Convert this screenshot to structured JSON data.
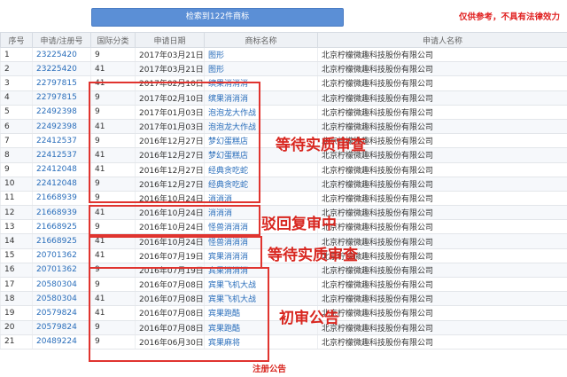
{
  "search_button": "检索到122件商标",
  "disclaimer": "仅供参考，不具有法律效力",
  "columns": [
    "序号",
    "申请/注册号",
    "国际分类",
    "申请日期",
    "商标名称",
    "申请人名称"
  ],
  "rows": [
    {
      "idx": "1",
      "num": "23225420",
      "cls": "9",
      "date": "2017年03月21日",
      "name": "图形",
      "applicant": "北京柠檬微趣科技股份有限公司"
    },
    {
      "idx": "2",
      "num": "23225420",
      "cls": "41",
      "date": "2017年03月21日",
      "name": "图形",
      "applicant": "北京柠檬微趣科技股份有限公司"
    },
    {
      "idx": "3",
      "num": "22797815",
      "cls": "41",
      "date": "2017年02月10日",
      "name": "缤果消消消",
      "applicant": "北京柠檬微趣科技股份有限公司"
    },
    {
      "idx": "4",
      "num": "22797815",
      "cls": "9",
      "date": "2017年02月10日",
      "name": "缤果消消消",
      "applicant": "北京柠檬微趣科技股份有限公司"
    },
    {
      "idx": "5",
      "num": "22492398",
      "cls": "9",
      "date": "2017年01月03日",
      "name": "泡泡龙大作战",
      "applicant": "北京柠檬微趣科技股份有限公司"
    },
    {
      "idx": "6",
      "num": "22492398",
      "cls": "41",
      "date": "2017年01月03日",
      "name": "泡泡龙大作战",
      "applicant": "北京柠檬微趣科技股份有限公司"
    },
    {
      "idx": "7",
      "num": "22412537",
      "cls": "9",
      "date": "2016年12月27日",
      "name": "梦幻蛋糕店",
      "applicant": "北京柠檬微趣科技股份有限公司"
    },
    {
      "idx": "8",
      "num": "22412537",
      "cls": "41",
      "date": "2016年12月27日",
      "name": "梦幻蛋糕店",
      "applicant": "北京柠檬微趣科技股份有限公司"
    },
    {
      "idx": "9",
      "num": "22412048",
      "cls": "41",
      "date": "2016年12月27日",
      "name": "经典贪吃蛇",
      "applicant": "北京柠檬微趣科技股份有限公司"
    },
    {
      "idx": "10",
      "num": "22412048",
      "cls": "9",
      "date": "2016年12月27日",
      "name": "经典贪吃蛇",
      "applicant": "北京柠檬微趣科技股份有限公司"
    },
    {
      "idx": "11",
      "num": "21668939",
      "cls": "9",
      "date": "2016年10月24日",
      "name": "消消消",
      "applicant": "北京柠檬微趣科技股份有限公司"
    },
    {
      "idx": "12",
      "num": "21668939",
      "cls": "41",
      "date": "2016年10月24日",
      "name": "消消消",
      "applicant": "北京柠檬微趣科技股份有限公司"
    },
    {
      "idx": "13",
      "num": "21668925",
      "cls": "9",
      "date": "2016年10月24日",
      "name": "怪兽消消消",
      "applicant": "北京柠檬微趣科技股份有限公司"
    },
    {
      "idx": "14",
      "num": "21668925",
      "cls": "41",
      "date": "2016年10月24日",
      "name": "怪兽消消消",
      "applicant": "北京柠檬微趣科技股份有限公司"
    },
    {
      "idx": "15",
      "num": "20701362",
      "cls": "41",
      "date": "2016年07月19日",
      "name": "宾果消消消",
      "applicant": "北京柠檬微趣科技股份有限公司"
    },
    {
      "idx": "16",
      "num": "20701362",
      "cls": "9",
      "date": "2016年07月19日",
      "name": "宾果消消消",
      "applicant": "北京柠檬微趣科技股份有限公司"
    },
    {
      "idx": "17",
      "num": "20580304",
      "cls": "9",
      "date": "2016年07月08日",
      "name": "宾果飞机大战",
      "applicant": "北京柠檬微趣科技股份有限公司"
    },
    {
      "idx": "18",
      "num": "20580304",
      "cls": "41",
      "date": "2016年07月08日",
      "name": "宾果飞机大战",
      "applicant": "北京柠檬微趣科技股份有限公司"
    },
    {
      "idx": "19",
      "num": "20579824",
      "cls": "41",
      "date": "2016年07月08日",
      "name": "宾果跑酷",
      "applicant": "北京柠檬微趣科技股份有限公司"
    },
    {
      "idx": "20",
      "num": "20579824",
      "cls": "9",
      "date": "2016年07月08日",
      "name": "宾果跑酷",
      "applicant": "北京柠檬微趣科技股份有限公司"
    },
    {
      "idx": "21",
      "num": "20489224",
      "cls": "9",
      "date": "2016年06月30日",
      "name": "宾果麻将",
      "applicant": "北京柠檬微趣科技股份有限公司"
    }
  ],
  "annotations": {
    "pending_review_1": "等待实质审查",
    "rejection_review": "驳回复审中",
    "pending_review_2": "等待实质审查",
    "preliminary_notice": "初审公告",
    "registration_notice": "注册公告"
  },
  "colors": {
    "accent": "#5b8fd6",
    "annotation_red": "#e0342f",
    "link": "#2a6ebb"
  }
}
